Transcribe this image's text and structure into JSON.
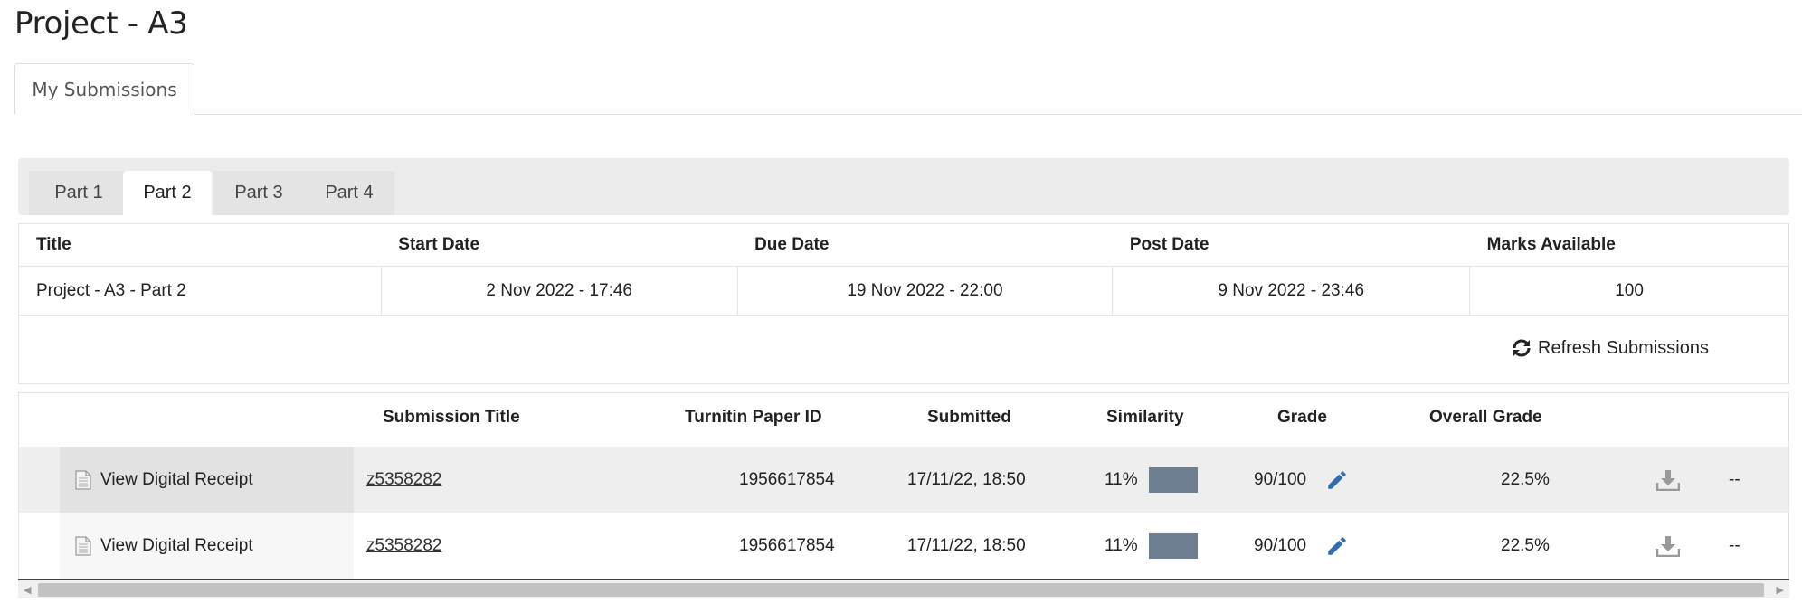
{
  "page": {
    "title": "Project - A3"
  },
  "top_tabs": [
    {
      "label": "My Submissions"
    }
  ],
  "part_tabs": [
    {
      "label": "Part 1",
      "active": false
    },
    {
      "label": "Part 2",
      "active": true
    },
    {
      "label": "Part 3",
      "active": false
    },
    {
      "label": "Part 4",
      "active": false
    }
  ],
  "info": {
    "headers": [
      "Title",
      "Start Date",
      "Due Date",
      "Post Date",
      "Marks Available"
    ],
    "row": [
      "Project - A3 - Part 2",
      "2 Nov 2022 - 17:46",
      "19 Nov 2022 - 22:00",
      "9 Nov 2022 - 23:46",
      "100"
    ]
  },
  "refresh": {
    "label": "Refresh Submissions",
    "icon": "refresh-icon"
  },
  "submissions": {
    "headers": {
      "title": "Submission Title",
      "paper_id": "Turnitin Paper ID",
      "submitted": "Submitted",
      "similarity": "Similarity",
      "grade": "Grade",
      "overall": "Overall Grade"
    },
    "rows": [
      {
        "receipt": "View Digital Receipt",
        "title": "z5358282",
        "paper_id": "1956617854",
        "submitted": "17/11/22, 18:50",
        "similarity": "11%",
        "grade": "90/100",
        "overall": "22.5%",
        "extra": "--"
      },
      {
        "receipt": "View Digital Receipt",
        "title": "z5358282",
        "paper_id": "1956617854",
        "submitted": "17/11/22, 18:50",
        "similarity": "11%",
        "grade": "90/100",
        "overall": "22.5%",
        "extra": "--"
      }
    ]
  },
  "colors": {
    "similarity_bar": "#6e7f92",
    "edit_icon": "#2f6fb0",
    "download_icon": "#999999"
  }
}
